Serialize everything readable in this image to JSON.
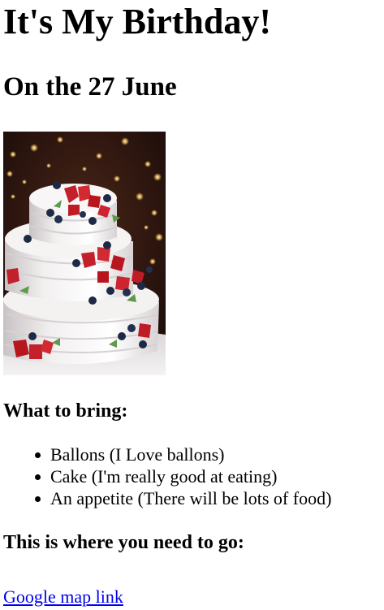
{
  "title": "It's My Birthday!",
  "date_heading": "On the 27 June",
  "image": {
    "subject": "cake-photo",
    "colors": {
      "background": "#2a140e",
      "cake": "#eeeaea",
      "strawberry": "#c2202a",
      "blueberry": "#1d2a45",
      "lights": "#ffd77a",
      "leaf": "#5f9a4a"
    }
  },
  "bring_heading": "What to bring:",
  "bring_items": [
    "Ballons (I Love ballons)",
    "Cake (I'm really good at eating)",
    "An appetite (There will be lots of food)"
  ],
  "directions_heading": "This is where you need to go:",
  "map_link_text": "Google map link"
}
